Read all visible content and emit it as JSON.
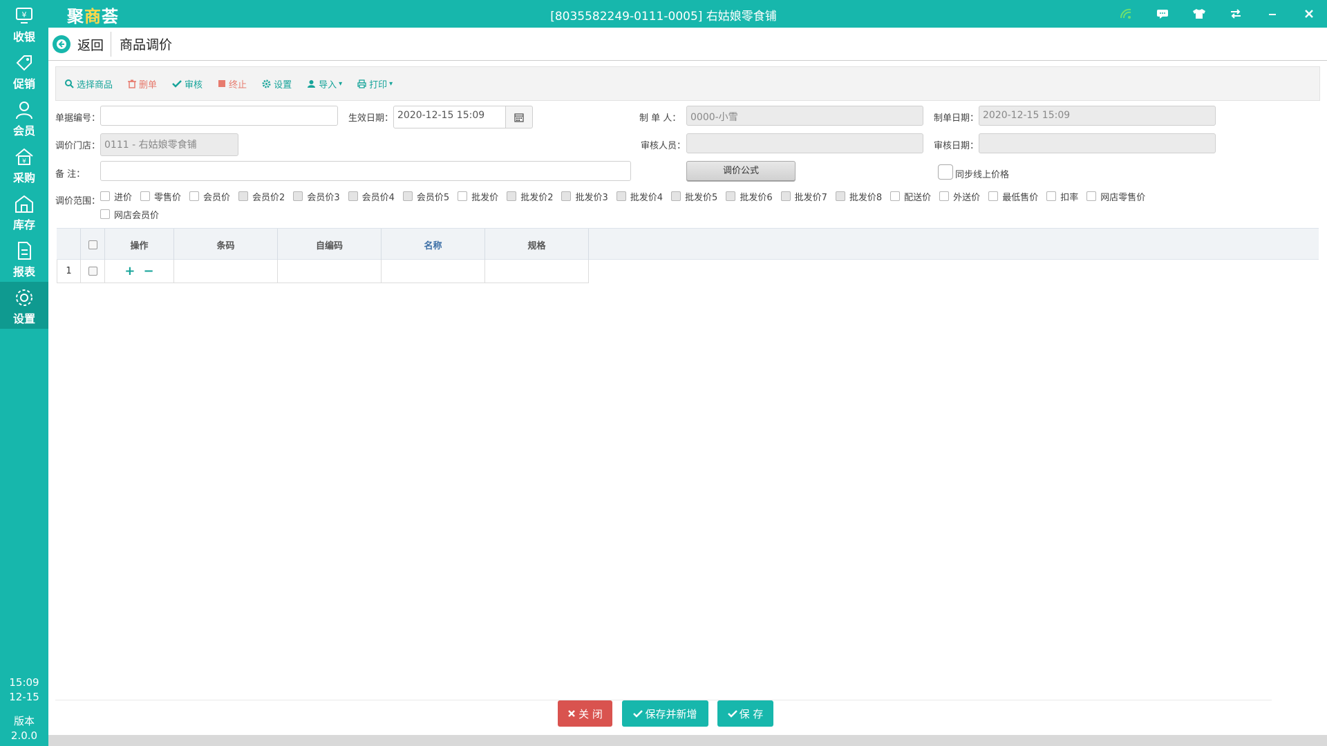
{
  "window": {
    "logo": {
      "main": "聚",
      "accent": "商",
      "tail": "荟"
    },
    "title": "[8035582249-0111-0005] 右姑娘零食铺",
    "controls": [
      "wifi-icon",
      "message-icon",
      "shirt-icon",
      "swap-icon",
      "minimize-icon",
      "close-icon"
    ]
  },
  "colors": {
    "accent": "#17b7ac",
    "danger": "#d9534f",
    "link_red": "#e77b6e"
  },
  "sidebar": {
    "items": [
      {
        "label": "收银",
        "icon": "cashier-icon"
      },
      {
        "label": "促销",
        "icon": "tag-icon"
      },
      {
        "label": "会员",
        "icon": "user-icon"
      },
      {
        "label": "采购",
        "icon": "purchase-icon"
      },
      {
        "label": "库存",
        "icon": "warehouse-icon"
      },
      {
        "label": "报表",
        "icon": "report-icon"
      },
      {
        "label": "设置",
        "icon": "gear-icon",
        "active": true
      }
    ],
    "time": "15:09",
    "date": "12-15",
    "version_label": "版本",
    "version": "2.0.0"
  },
  "header": {
    "back_label": "返回",
    "title": "商品调价"
  },
  "toolbar": {
    "select_goods": "选择商品",
    "delete": "删单",
    "audit": "审核",
    "stop": "终止",
    "settings": "设置",
    "import": "导入",
    "print": "打印"
  },
  "form": {
    "doc_no_label": "单据编号：",
    "doc_no": "",
    "effective_label": "生效日期：",
    "effective_date": "2020-12-15 15:09",
    "maker_label": "制  单  人：",
    "maker": "0000-小雪",
    "make_date_label": "制单日期：",
    "make_date": "2020-12-15 15:09",
    "store_label": "调价门店：",
    "store": "0111 - 右姑娘零食铺",
    "auditor_label": "审核人员：",
    "auditor": "",
    "audit_date_label": "审核日期：",
    "audit_date": "",
    "remark_label": "备      注：",
    "remark": "",
    "formula_button": "调价公式",
    "sync_label": "同步线上价格",
    "range_label": "调价范围：",
    "ranges": [
      {
        "label": "进价",
        "disabled": false
      },
      {
        "label": "零售价",
        "disabled": false
      },
      {
        "label": "会员价",
        "disabled": false
      },
      {
        "label": "会员价2",
        "disabled": true
      },
      {
        "label": "会员价3",
        "disabled": true
      },
      {
        "label": "会员价4",
        "disabled": true
      },
      {
        "label": "会员价5",
        "disabled": true
      },
      {
        "label": "批发价",
        "disabled": false
      },
      {
        "label": "批发价2",
        "disabled": true
      },
      {
        "label": "批发价3",
        "disabled": true
      },
      {
        "label": "批发价4",
        "disabled": true
      },
      {
        "label": "批发价5",
        "disabled": true
      },
      {
        "label": "批发价6",
        "disabled": true
      },
      {
        "label": "批发价7",
        "disabled": true
      },
      {
        "label": "批发价8",
        "disabled": true
      },
      {
        "label": "配送价",
        "disabled": false
      },
      {
        "label": "外送价",
        "disabled": false
      },
      {
        "label": "最低售价",
        "disabled": false
      },
      {
        "label": "扣率",
        "disabled": false
      },
      {
        "label": "网店零售价",
        "disabled": false
      },
      {
        "label": "网店会员价",
        "disabled": false
      }
    ]
  },
  "table": {
    "headers": {
      "op": "操作",
      "barcode": "条码",
      "selfcode": "自编码",
      "name": "名称",
      "spec": "规格"
    },
    "rows": [
      {
        "index": "1",
        "barcode": "",
        "selfcode": "",
        "name": "",
        "spec": ""
      }
    ]
  },
  "footer": {
    "close": "关 闭",
    "save_new": "保存并新增",
    "save": "保 存"
  }
}
